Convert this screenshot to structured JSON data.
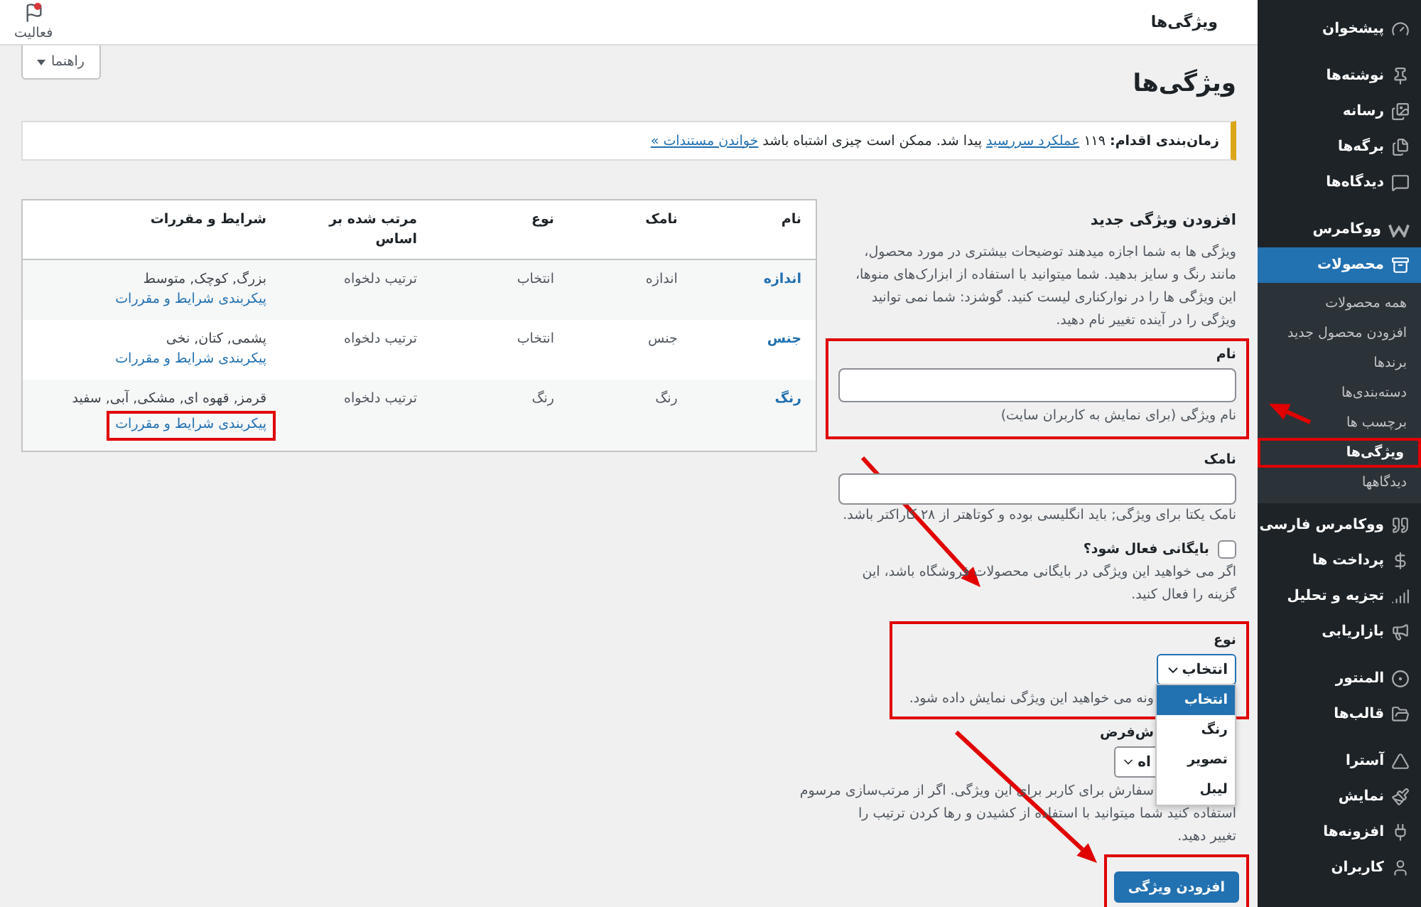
{
  "sidebar": {
    "items": [
      {
        "label": "پیشخوان",
        "selected": false
      },
      {
        "label": "نوشته‌ها",
        "selected": false
      },
      {
        "label": "رسانه",
        "selected": false
      },
      {
        "label": "برگه‌ها",
        "selected": false
      },
      {
        "label": "دیدگاه‌ها",
        "selected": false
      },
      {
        "label": "ووکامرس",
        "selected": false
      },
      {
        "label": "محصولات",
        "selected": true,
        "children": [
          {
            "label": "همه محصولات",
            "selected": false
          },
          {
            "label": "افزودن محصول جدید",
            "selected": false
          },
          {
            "label": "برندها",
            "selected": false
          },
          {
            "label": "دسته‌بندی‌ها",
            "selected": false
          },
          {
            "label": "برچسب ها",
            "selected": false
          },
          {
            "label": "ویژگی‌ها",
            "selected": true,
            "highlighted": true
          },
          {
            "label": "دیدگاهها",
            "selected": false
          }
        ]
      },
      {
        "label": "ووکامرس فارسی",
        "selected": false
      },
      {
        "label": "پرداخت ها",
        "selected": false
      },
      {
        "label": "تجزیه و تحلیل",
        "selected": false
      },
      {
        "label": "بازاریابی",
        "selected": false
      },
      {
        "label": "المنتور",
        "selected": false
      },
      {
        "label": "قالب‌ها",
        "selected": false
      },
      {
        "label": "آسترا",
        "selected": false
      },
      {
        "label": "نمایش",
        "selected": false
      },
      {
        "label": "افزونه‌ها",
        "selected": false
      },
      {
        "label": "کاربران",
        "selected": false
      }
    ]
  },
  "header": {
    "title": "ویژگی‌ها",
    "activity": "فعالیت"
  },
  "help_button": "راهنما",
  "page_title": "ویژگی‌ها",
  "notice": {
    "parts": [
      {
        "kind": "bold",
        "text": "زمان‌بندی اقدام:"
      },
      {
        "kind": "text",
        "text": " ۱۱۹ "
      },
      {
        "kind": "link",
        "text": "عملکرد سررسید"
      },
      {
        "kind": "text",
        "text": " پیدا شد. ممکن است چیزی اشتباه باشد "
      },
      {
        "kind": "link",
        "text": "خواندن مستندات »"
      }
    ]
  },
  "table": {
    "columns": [
      "نام",
      "نامک",
      "نوع",
      "مرتب شده بر اساس",
      "شرایط و مقررات"
    ],
    "rows": [
      {
        "name": "اندازه",
        "slug": "اندازه",
        "type": "انتخاب",
        "order": "ترتیب دلخواه",
        "terms": "بزرگ, کوچک, متوسط",
        "configure": "پیکربندی شرایط و مقررات"
      },
      {
        "name": "جنس",
        "slug": "جنس",
        "type": "انتخاب",
        "order": "ترتیب دلخواه",
        "terms": "پشمی, کتان, نخی",
        "configure": "پیکربندی شرایط و مقررات"
      },
      {
        "name": "رنگ",
        "slug": "رنگ",
        "type": "رنگ",
        "order": "ترتیب دلخواه",
        "terms": "قرمز, قهوه ای, مشکی, آبی, سفید",
        "configure": "پیکربندی شرایط و مقررات",
        "highlighted": true
      }
    ]
  },
  "form": {
    "title": "افزودن ویژگی جدید",
    "description": "ویژگی ها به شما اجازه میدهند توضیحات بیشتری در مورد محصول، مانند رنگ و سایز بدهید. شما میتوانید با استفاده از ابزارک‌های منوها، این ویژگی ها را در نوارکناری لیست کنید. گوشزد: شما نمی توانید ویژگی را در آینده تغییر نام دهید.",
    "name_label": "نام",
    "name_hint": "نام ویژگی (برای نمایش به کاربران سایت)",
    "slug_label": "نامک",
    "slug_hint": "نامک یکتا برای ویژگی; باید انگلیسی بوده و کوتاهتر از ۲۸ کاراکتر باشد.",
    "archive": {
      "label": "بایگانی فعال شود؟",
      "checked": false,
      "hint": "اگر می خواهید این ویژگی در بایگانی محصولات فروشگاه باشد، این گزینه را فعال کنید."
    },
    "type": {
      "label": "نوع",
      "value": "انتخاب",
      "hint": "ونه می خواهید این ویژگی نمایش داده شود.",
      "options": [
        {
          "label": "انتخاب",
          "selected": true
        },
        {
          "label": "رنگ",
          "selected": false
        },
        {
          "label": "تصویر",
          "selected": false
        },
        {
          "label": "لیبل",
          "selected": false
        }
      ]
    },
    "order": {
      "label": "ش‌فرض",
      "value": "اه",
      "hint_first": "سفارش برای کاربر برای این ویژگی. اگر از مرتب‌سازی مرسوم",
      "hint_rest": "استفاده کنید شما میتوانید با استفاده از کشیدن و رها کردن ترتیب را تغییر دهید."
    },
    "submit": "افزودن ویژگی"
  }
}
